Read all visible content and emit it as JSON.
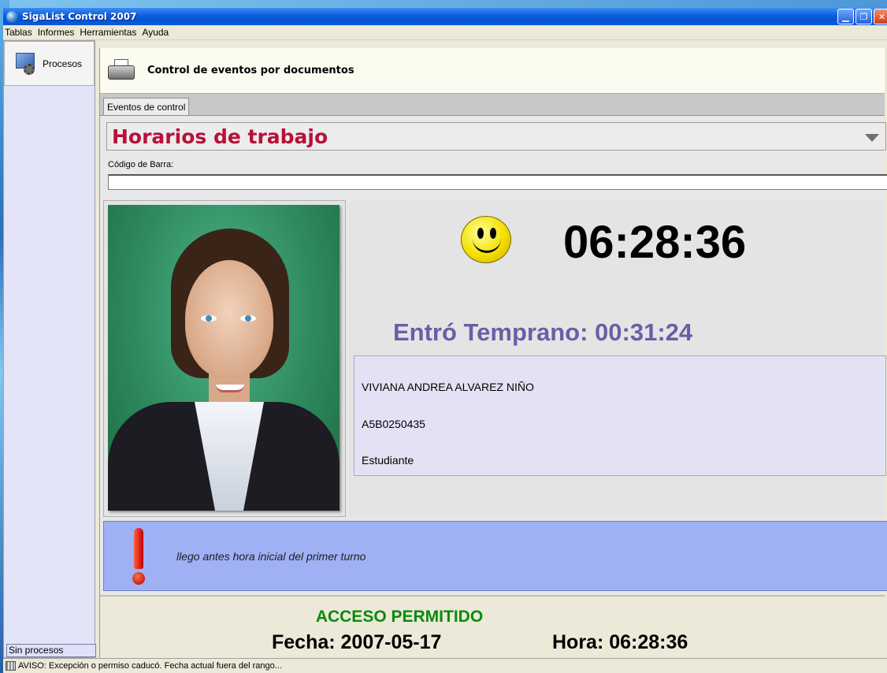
{
  "window": {
    "title": "SigaList Control 2007"
  },
  "menu": [
    "Tablas",
    "Informes",
    "Herramientas",
    "Ayuda"
  ],
  "sidebar": {
    "process_button": "Procesos",
    "status": "Sin procesos"
  },
  "header": {
    "title": "Control de eventos por documentos"
  },
  "tabs": [
    {
      "label": "Eventos de control"
    }
  ],
  "form": {
    "schedule_selected": "Horarios de trabajo",
    "barcode_label": "Código de Barra:",
    "barcode_value": ""
  },
  "event": {
    "clock": "06:28:36",
    "early_message": "Entró Temprano: 00:31:24",
    "person_name": "VIVIANA ANDREA ALVAREZ NIÑO",
    "person_id": "A5B0250435",
    "person_role": "Estudiante",
    "notice": "llego antes hora inicial del primer turno",
    "access": "ACCESO PERMITIDO",
    "date_line": "Fecha: 2007-05-17",
    "time_line": "Hora: 06:28:36"
  },
  "statusbar": {
    "text": "AVISO: Excepción o permiso caducó. Fecha actual fuera del rango..."
  },
  "colors": {
    "schedule_text": "#b8103a",
    "early_text": "#6a5ea8",
    "access_text": "#0a8a0a",
    "notice_band": "#9fb0f4"
  }
}
